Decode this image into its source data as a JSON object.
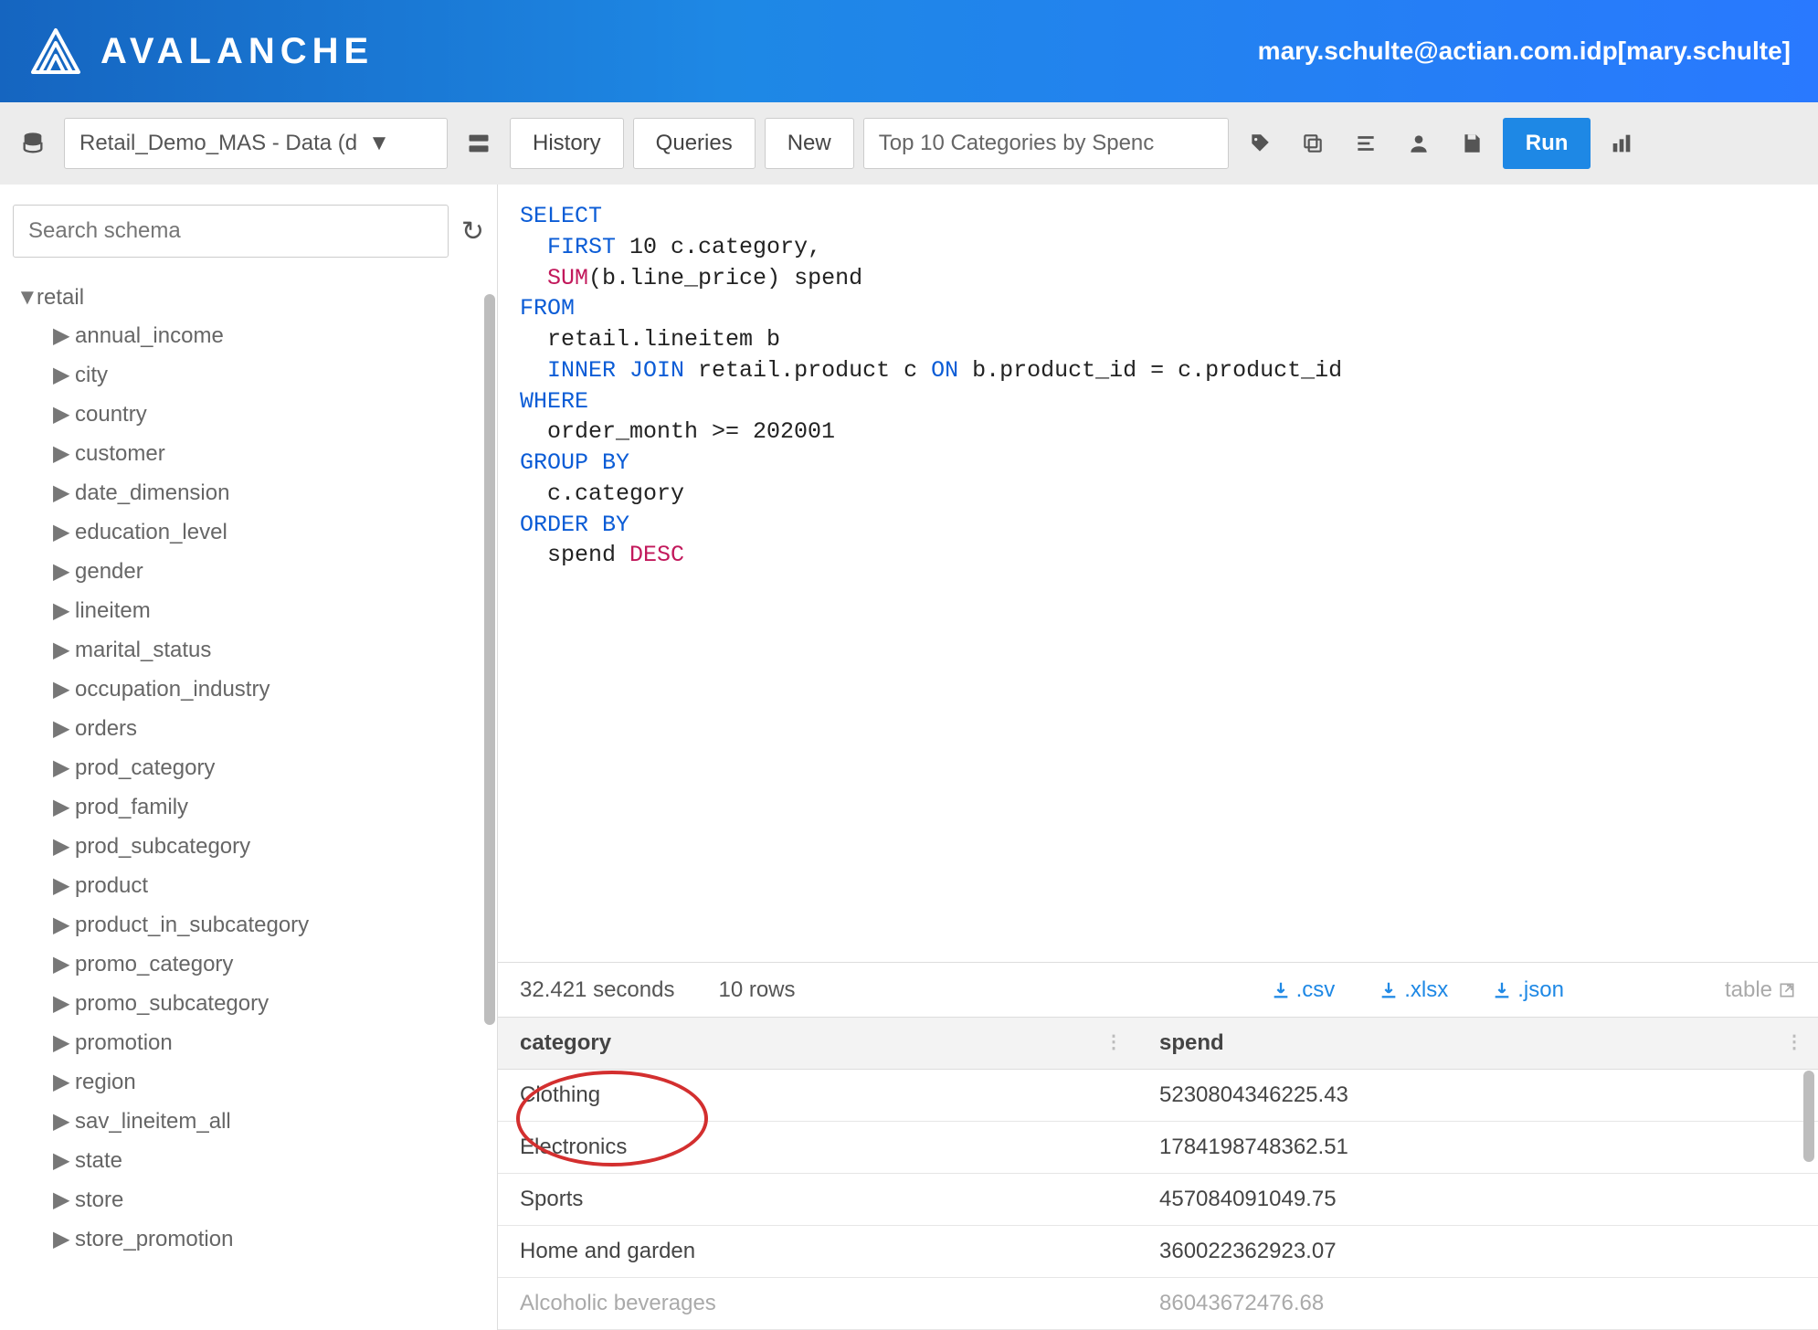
{
  "header": {
    "brand": "AVALANCHE",
    "user": "mary.schulte@actian.com.idp[mary.schulte]"
  },
  "toolbar": {
    "connection": "Retail_Demo_MAS - Data (d",
    "history": "History",
    "queries": "Queries",
    "new": "New",
    "query_name": "Top 10 Categories by Spenc",
    "run": "Run"
  },
  "sidebar": {
    "search_placeholder": "Search schema",
    "schema": "retail",
    "tables": [
      "annual_income",
      "city",
      "country",
      "customer",
      "date_dimension",
      "education_level",
      "gender",
      "lineitem",
      "marital_status",
      "occupation_industry",
      "orders",
      "prod_category",
      "prod_family",
      "prod_subcategory",
      "product",
      "product_in_subcategory",
      "promo_category",
      "promo_subcategory",
      "promotion",
      "region",
      "sav_lineitem_all",
      "state",
      "store",
      "store_promotion"
    ]
  },
  "sql": [
    {
      "kw": "SELECT"
    },
    {
      "indent": 1,
      "kw": "FIRST",
      "rest": " 10 c.category,"
    },
    {
      "indent": 1,
      "fn": "SUM",
      "rest": "(b.line_price) spend"
    },
    {
      "kw": "FROM"
    },
    {
      "indent": 1,
      "rest": "retail.lineitem b"
    },
    {
      "indent": 1,
      "kw": "INNER JOIN",
      "mid": " retail.product c ",
      "kw2": "ON",
      "rest2": " b.product_id = c.product_id"
    },
    {
      "kw": "WHERE"
    },
    {
      "indent": 1,
      "rest": "order_month >= 202001"
    },
    {
      "kw": "GROUP BY"
    },
    {
      "indent": 1,
      "rest": "c.category"
    },
    {
      "kw": "ORDER BY"
    },
    {
      "indent": 1,
      "rest": "spend ",
      "desc": "DESC"
    }
  ],
  "results": {
    "elapsed": "32.421 seconds",
    "rowcount": "10 rows",
    "downloads": {
      "csv": ".csv",
      "xlsx": ".xlsx",
      "json": ".json"
    },
    "table_link": "table",
    "columns": [
      "category",
      "spend"
    ],
    "rows": [
      {
        "category": "Clothing",
        "spend": "5230804346225.43"
      },
      {
        "category": "Electronics",
        "spend": "1784198748362.51"
      },
      {
        "category": "Sports",
        "spend": "457084091049.75"
      },
      {
        "category": "Home and garden",
        "spend": "360022362923.07"
      },
      {
        "category": "Alcoholic beverages",
        "spend": "86043672476.68"
      }
    ]
  }
}
